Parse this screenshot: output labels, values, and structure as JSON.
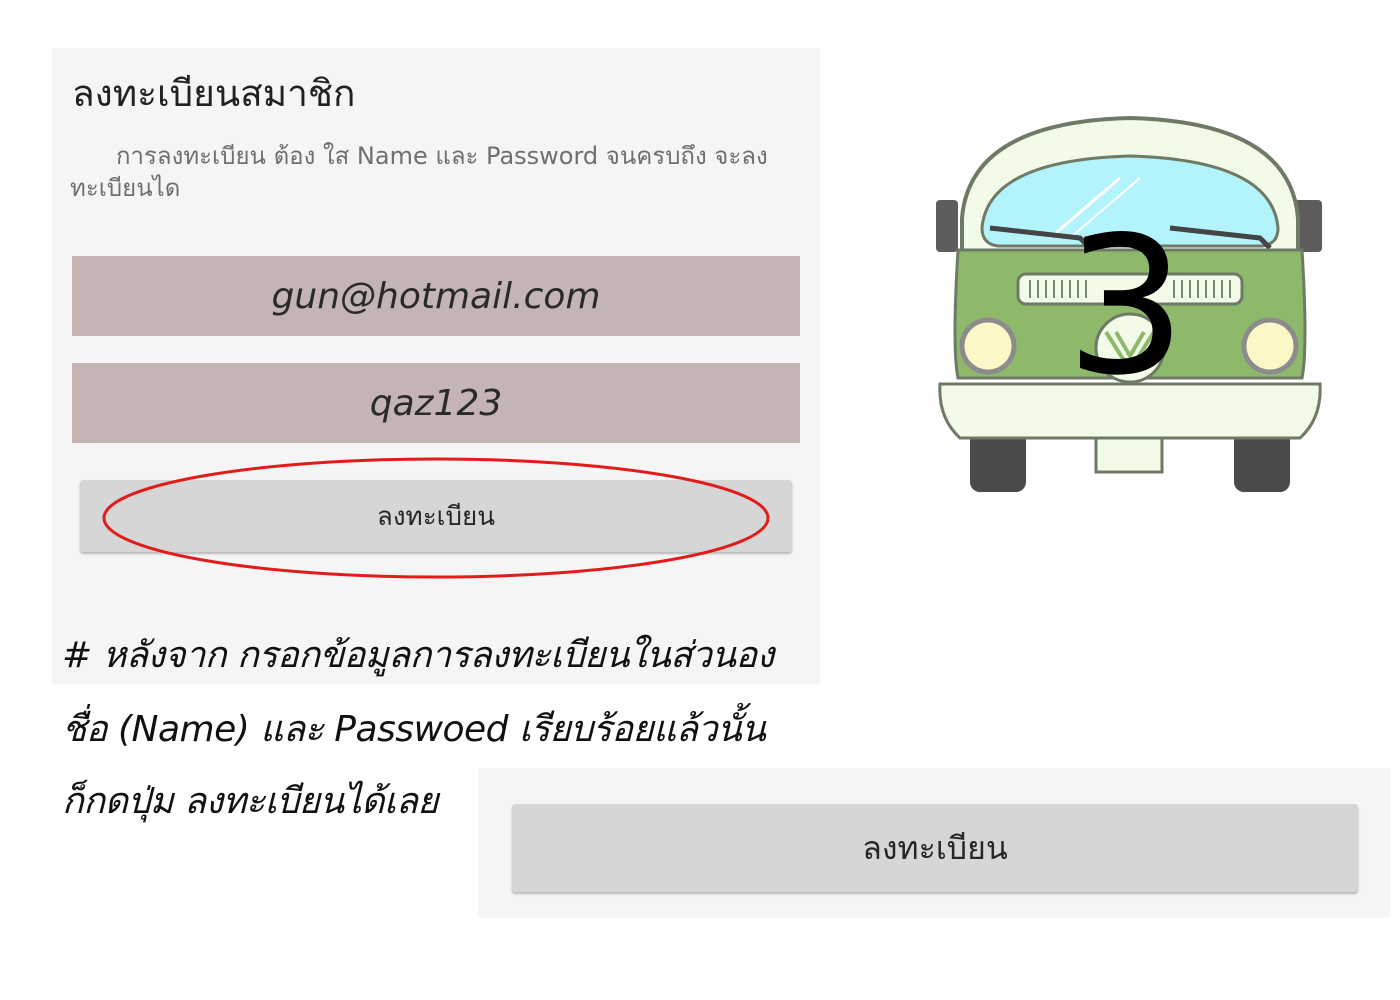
{
  "register_form": {
    "title": "ลงทะเบียนสมาชิก",
    "description": "การลงทะเบียน ต้อง ใส Name และ Password จนครบถึง จะลงทะเบียนได",
    "email_value": "gun@hotmail.com",
    "password_value": "qaz123",
    "register_label": "ลงทะเบียน"
  },
  "instruction": {
    "line1": "# หลังจาก กรอกข้อมูลการลงทะเบียนในส่วนอง",
    "line2": "ชื่อ (Name) และ Passwoed เรียบร้อยแล้วนั้น",
    "line3": "ก็กดปุ่ม ลงทะเบียนได้เลย"
  },
  "zoom_button": {
    "label": "ลงทะเบียน"
  },
  "step": {
    "number": "3"
  },
  "colors": {
    "field_background": "#c4b5b4",
    "button_background": "#d6d6d6",
    "highlight_circle": "#e21b1b",
    "van_body": "#8fb96a",
    "van_window": "#b3f3fb"
  },
  "icons": {
    "step_illustration": "van-icon"
  }
}
